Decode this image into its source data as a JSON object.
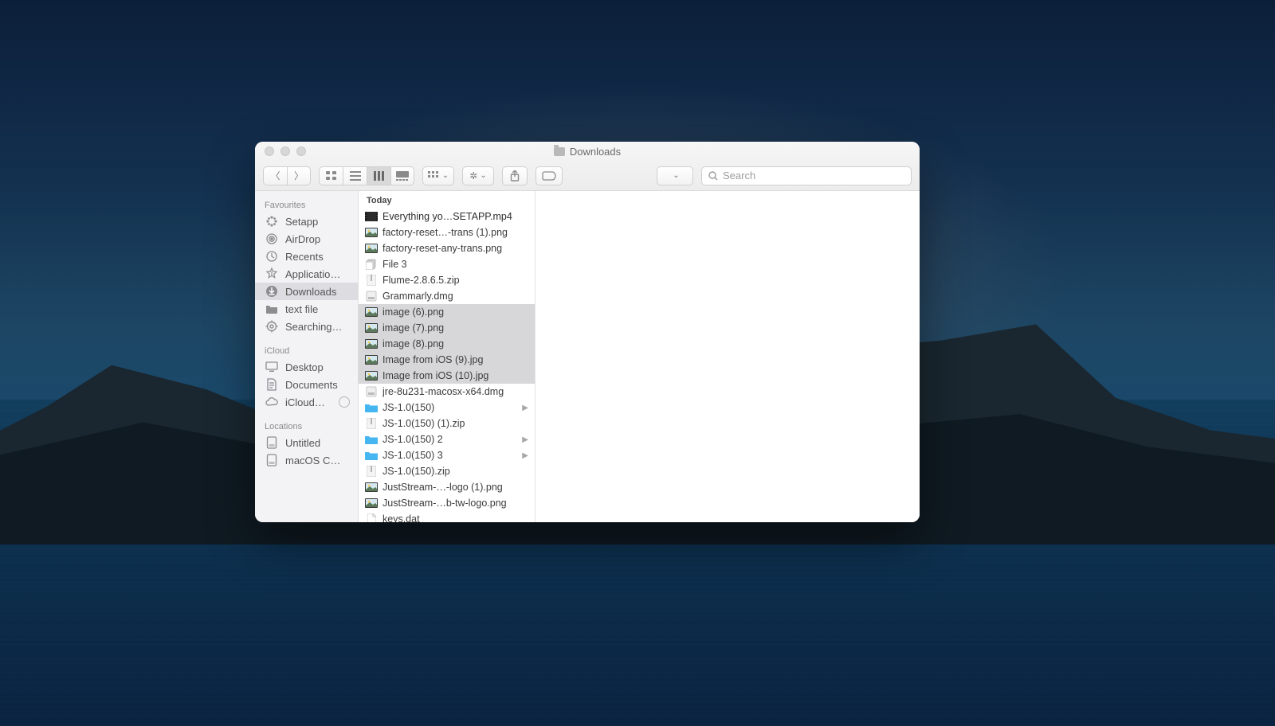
{
  "window": {
    "title": "Downloads"
  },
  "toolbar": {
    "search_placeholder": "Search"
  },
  "sidebar": {
    "sections": [
      {
        "title": "Favourites",
        "items": [
          {
            "icon": "setapp",
            "label": "Setapp"
          },
          {
            "icon": "airdrop",
            "label": "AirDrop"
          },
          {
            "icon": "recents",
            "label": "Recents"
          },
          {
            "icon": "apps",
            "label": "Applicatio…"
          },
          {
            "icon": "downloads",
            "label": "Downloads",
            "selected": true
          },
          {
            "icon": "folder",
            "label": "text file"
          },
          {
            "icon": "gear",
            "label": "Searching…"
          }
        ]
      },
      {
        "title": "iCloud",
        "items": [
          {
            "icon": "desktop",
            "label": "Desktop"
          },
          {
            "icon": "docs",
            "label": "Documents"
          },
          {
            "icon": "cloud",
            "label": "iCloud…",
            "progress": true
          }
        ]
      },
      {
        "title": "Locations",
        "items": [
          {
            "icon": "disk",
            "label": "Untitled"
          },
          {
            "icon": "disk",
            "label": "macOS C…"
          }
        ]
      }
    ]
  },
  "column": {
    "header": "Today",
    "rows": [
      {
        "icon": "video",
        "name": "Everything yo…SETAPP.mp4",
        "sel": false,
        "cut": true
      },
      {
        "icon": "img",
        "name": "factory-reset…-trans (1).png",
        "sel": false
      },
      {
        "icon": "img",
        "name": "factory-reset-any-trans.png",
        "sel": false
      },
      {
        "icon": "stack",
        "name": "File 3",
        "sel": false
      },
      {
        "icon": "zip",
        "name": "Flume-2.8.6.5.zip",
        "sel": false
      },
      {
        "icon": "dmg",
        "name": "Grammarly.dmg",
        "sel": false
      },
      {
        "icon": "img",
        "name": "image (6).png",
        "sel": true
      },
      {
        "icon": "img",
        "name": "image (7).png",
        "sel": true
      },
      {
        "icon": "img",
        "name": "image (8).png",
        "sel": true
      },
      {
        "icon": "img",
        "name": "Image from iOS (9).jpg",
        "sel": true
      },
      {
        "icon": "img",
        "name": "Image from iOS (10).jpg",
        "sel": true
      },
      {
        "icon": "dmg",
        "name": "jre-8u231-macosx-x64.dmg",
        "sel": false
      },
      {
        "icon": "folder",
        "name": "JS-1.0(150)",
        "sel": false,
        "folder": true
      },
      {
        "icon": "zip",
        "name": "JS-1.0(150) (1).zip",
        "sel": false
      },
      {
        "icon": "folder",
        "name": "JS-1.0(150) 2",
        "sel": false,
        "folder": true
      },
      {
        "icon": "folder",
        "name": "JS-1.0(150) 3",
        "sel": false,
        "folder": true
      },
      {
        "icon": "zip",
        "name": "JS-1.0(150).zip",
        "sel": false
      },
      {
        "icon": "img",
        "name": "JustStream-…-logo (1).png",
        "sel": false
      },
      {
        "icon": "img",
        "name": "JustStream-…b-tw-logo.png",
        "sel": false
      },
      {
        "icon": "doc",
        "name": "keys.dat",
        "sel": false
      }
    ]
  }
}
